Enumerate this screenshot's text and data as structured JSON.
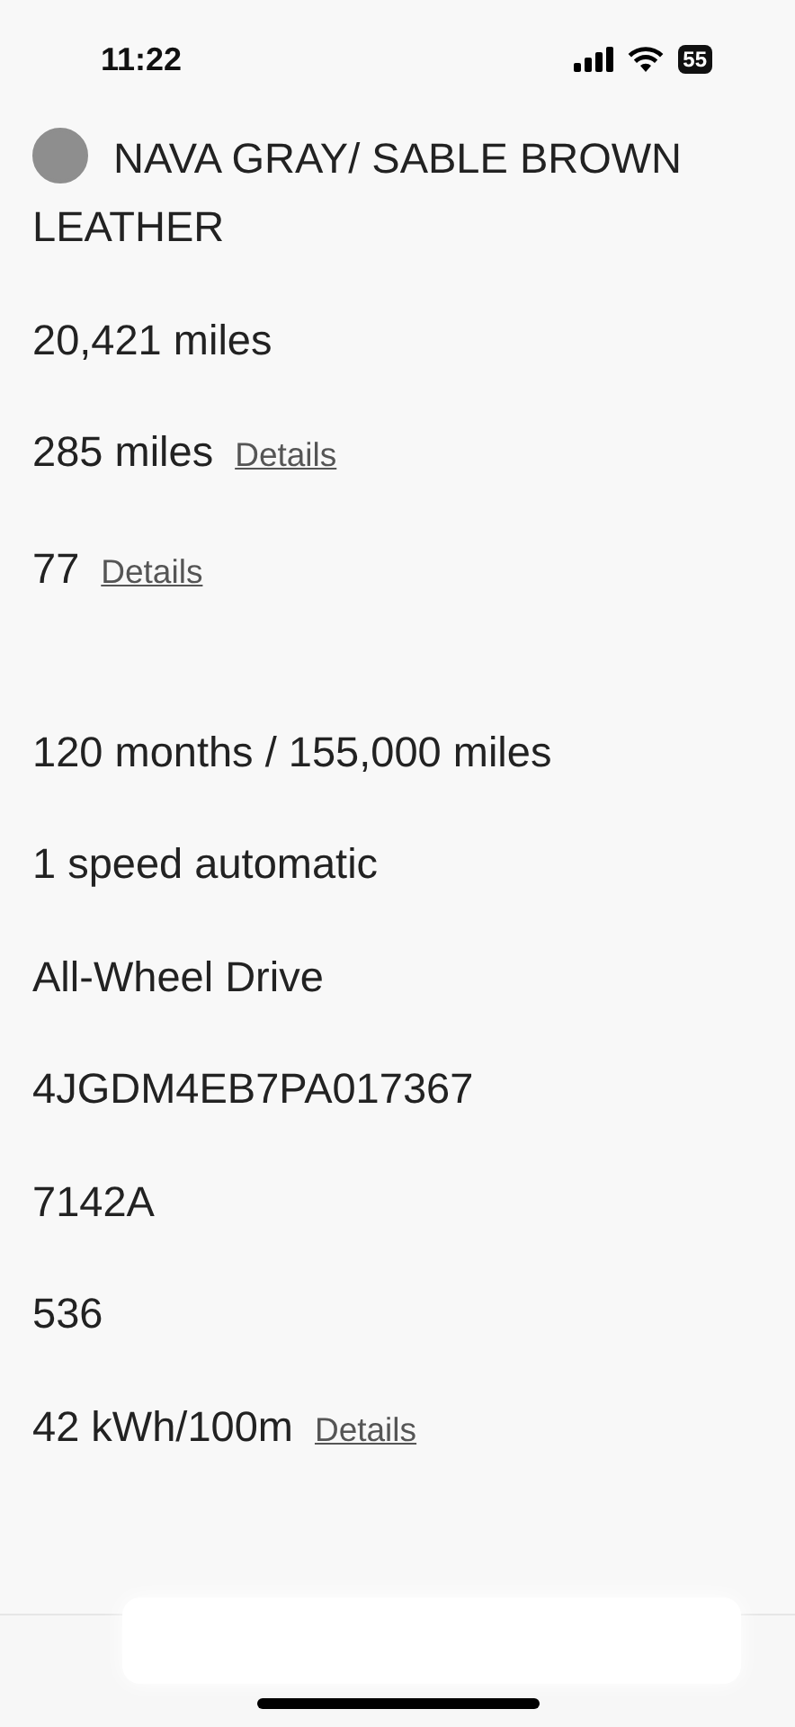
{
  "status_bar": {
    "time": "11:22",
    "battery": "55"
  },
  "specs": [
    {
      "kind": "swatch",
      "value": "NAVA GRAY/ SABLE BROWN LEATHER",
      "color": "#8e8e8e"
    },
    {
      "kind": "plain",
      "value": "20,421 miles"
    },
    {
      "kind": "plain",
      "value": "285 miles",
      "link": "Details"
    },
    {
      "kind": "plain",
      "value": "77",
      "link": "Details"
    },
    {
      "kind": "spacer"
    },
    {
      "kind": "plain",
      "value": "120 months / 155,000 miles"
    },
    {
      "kind": "plain",
      "value": "1 speed automatic"
    },
    {
      "kind": "plain",
      "value": "All-Wheel Drive"
    },
    {
      "kind": "plain",
      "value": "4JGDM4EB7PA017367"
    },
    {
      "kind": "plain",
      "value": "7142A"
    },
    {
      "kind": "plain",
      "value": "536"
    },
    {
      "kind": "plain",
      "value": "42 kWh/100m",
      "link": "Details"
    }
  ]
}
